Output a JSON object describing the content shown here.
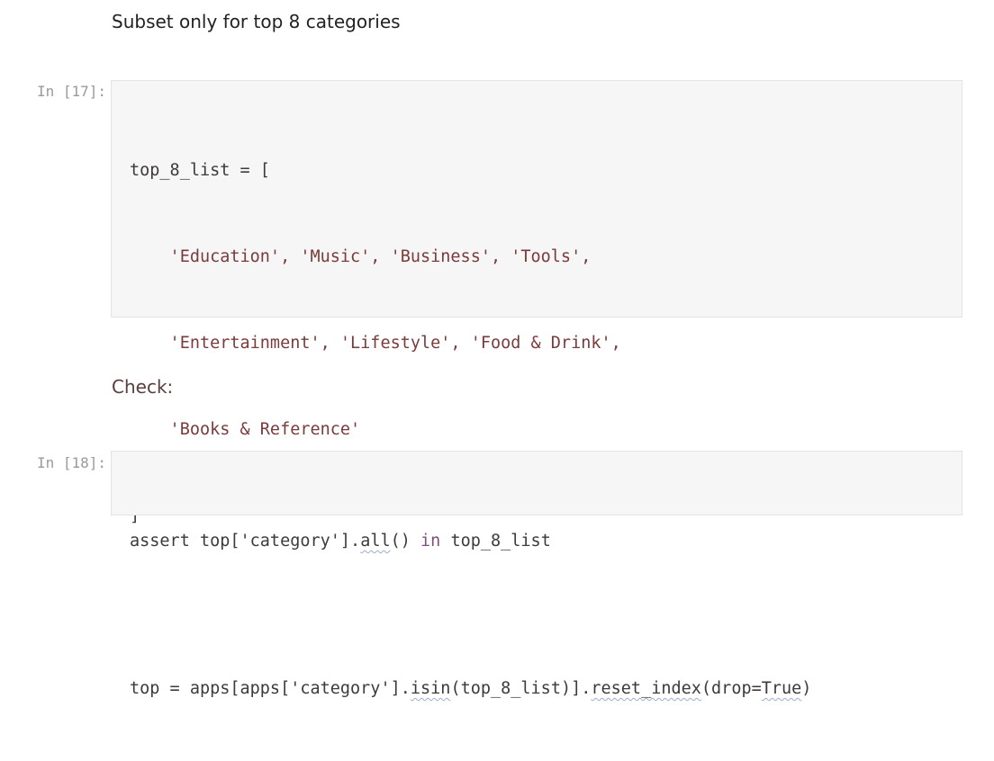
{
  "markdown": {
    "heading": "Subset only for top 8 categories",
    "check": "Check:"
  },
  "cells": {
    "c17": {
      "prompt": "In [17]:",
      "lines": {
        "l1": "top_8_list = [",
        "l2": "    'Education', 'Music', 'Business', 'Tools',",
        "l3": "    'Entertainment', 'Lifestyle', 'Food & Drink',",
        "l4": "    'Books & Reference'",
        "l5": "]",
        "l6": "",
        "l7a": "top = apps[apps['category'].",
        "l7b": "isin",
        "l7c": "(top_8_list)].",
        "l7d": "reset_index",
        "l7e": "(drop=",
        "l7f": "True",
        "l7g": ")"
      }
    },
    "c18": {
      "prompt": "In [18]:",
      "lines": {
        "l1a": "assert",
        "l1b": " top['category'].",
        "l1c": "all",
        "l1d": "() ",
        "l1e": "in",
        "l1f": " top_8_list"
      }
    }
  }
}
